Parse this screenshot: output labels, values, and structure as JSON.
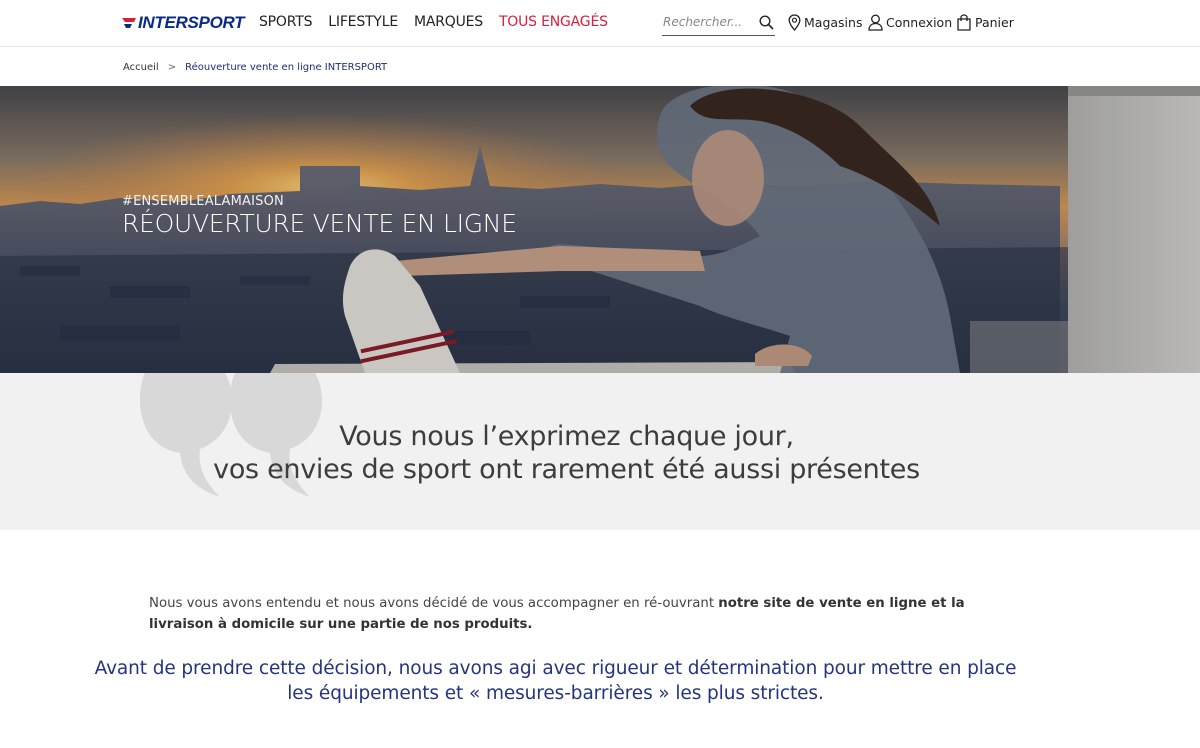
{
  "header": {
    "logo_text": "INTERSPORT",
    "nav": [
      {
        "label": "SPORTS"
      },
      {
        "label": "LIFESTYLE"
      },
      {
        "label": "MARQUES"
      },
      {
        "label": "TOUS ENGAGÉS",
        "accent": true
      }
    ],
    "search": {
      "placeholder": "Rechercher..."
    },
    "stores_label": "Magasins",
    "login_label": "Connexion",
    "cart_label": "Panier"
  },
  "breadcrumb": {
    "home": "Accueil",
    "separator": ">",
    "current": "Réouverture vente en ligne INTERSPORT"
  },
  "hero": {
    "tag": "#ENSEMBLEALAMAISON",
    "title": "RÉOUVERTURE VENTE EN LIGNE"
  },
  "quote": {
    "line1": "Vous nous l’exprimez chaque jour,",
    "line2": "vos envies de sport ont rarement été aussi présentes"
  },
  "intro": {
    "text_before": "Nous vous avons entendu et nous avons décidé de vous accompagner en ré-ouvrant ",
    "text_bold": "notre site de vente en ligne et la livraison à domicile sur une partie de nos produits."
  },
  "statement": {
    "line1": "Avant de prendre cette décision, nous avons agi avec rigueur et détermination pour mettre en place",
    "line2": "les équipements et « mesures-barrières » les plus strictes."
  },
  "colors": {
    "brand_blue": "#0a2a8a",
    "brand_red": "#d81e3c",
    "statement_blue": "#24347f",
    "quote_band": "#f1f1f1"
  }
}
